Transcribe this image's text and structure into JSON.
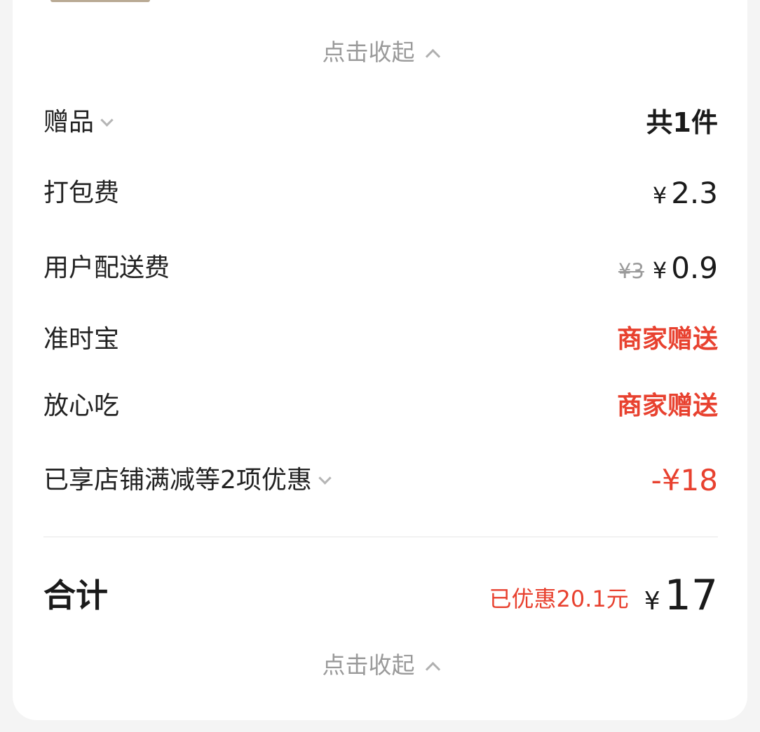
{
  "collapse_label": "点击收起",
  "rows": {
    "gift": {
      "label": "赠品",
      "value": "共1件"
    },
    "packing": {
      "label": "打包费",
      "currency": "¥",
      "amount": "2.3"
    },
    "delivery": {
      "label": "用户配送费",
      "original": "¥3",
      "currency": "¥",
      "amount": "0.9"
    },
    "on_time": {
      "label": "准时宝",
      "value": "商家赠送"
    },
    "safe_eat": {
      "label": "放心吃",
      "value": "商家赠送"
    },
    "discount": {
      "label": "已享店铺满减等2项优惠",
      "value": "-¥18"
    }
  },
  "total": {
    "label": "合计",
    "saved": "已优惠20.1元",
    "currency": "¥",
    "amount": "17"
  },
  "colors": {
    "accent_red": "#e8412f",
    "text_dark": "#222222",
    "text_gray": "#9a9a9a"
  },
  "icons": [
    "chevron-up-icon",
    "chevron-down-icon"
  ]
}
